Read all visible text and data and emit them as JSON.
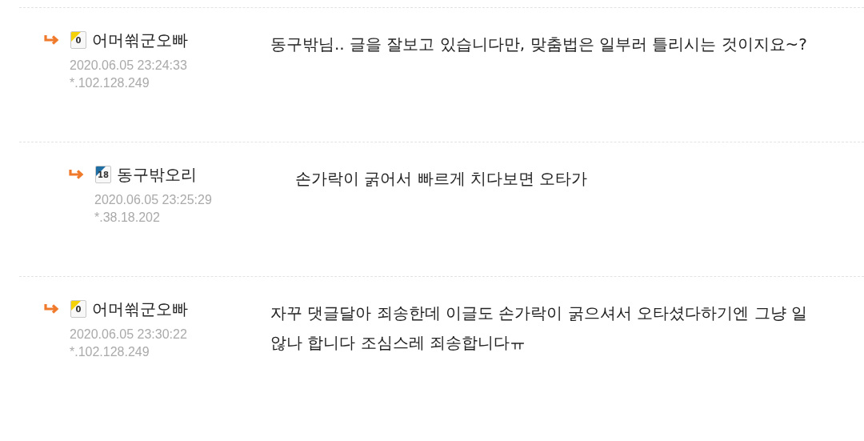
{
  "comments": [
    {
      "author": "어머쒺군오빠",
      "badge": {
        "label": "0",
        "color": "#f5d10a"
      },
      "date": "2020.06.05 23:24:33",
      "ip": "*.102.128.249",
      "lines": [
        "동구밖님.. 글을 잘보고 있습니다만, 맞춤법은 일부러 틀리시는 것이지요~?"
      ],
      "children": [
        {
          "author": "동구밖오리",
          "badge": {
            "label": "18",
            "color": "#1f6ea3"
          },
          "date": "2020.06.05 23:25:29",
          "ip": "*.38.18.202",
          "lines": [
            "손가락이 굵어서 빠르게 치다보면 오타가"
          ]
        }
      ]
    },
    {
      "author": "어머쒺군오빠",
      "badge": {
        "label": "0",
        "color": "#f5d10a"
      },
      "date": "2020.06.05 23:30:22",
      "ip": "*.102.128.249",
      "lines": [
        "자꾸 댓글달아 죄송한데 이글도 손가락이 굵으셔서 오타셨다하기엔 그냥 일",
        "않나 합니다 조심스레 죄송합니다ㅠ"
      ]
    }
  ]
}
